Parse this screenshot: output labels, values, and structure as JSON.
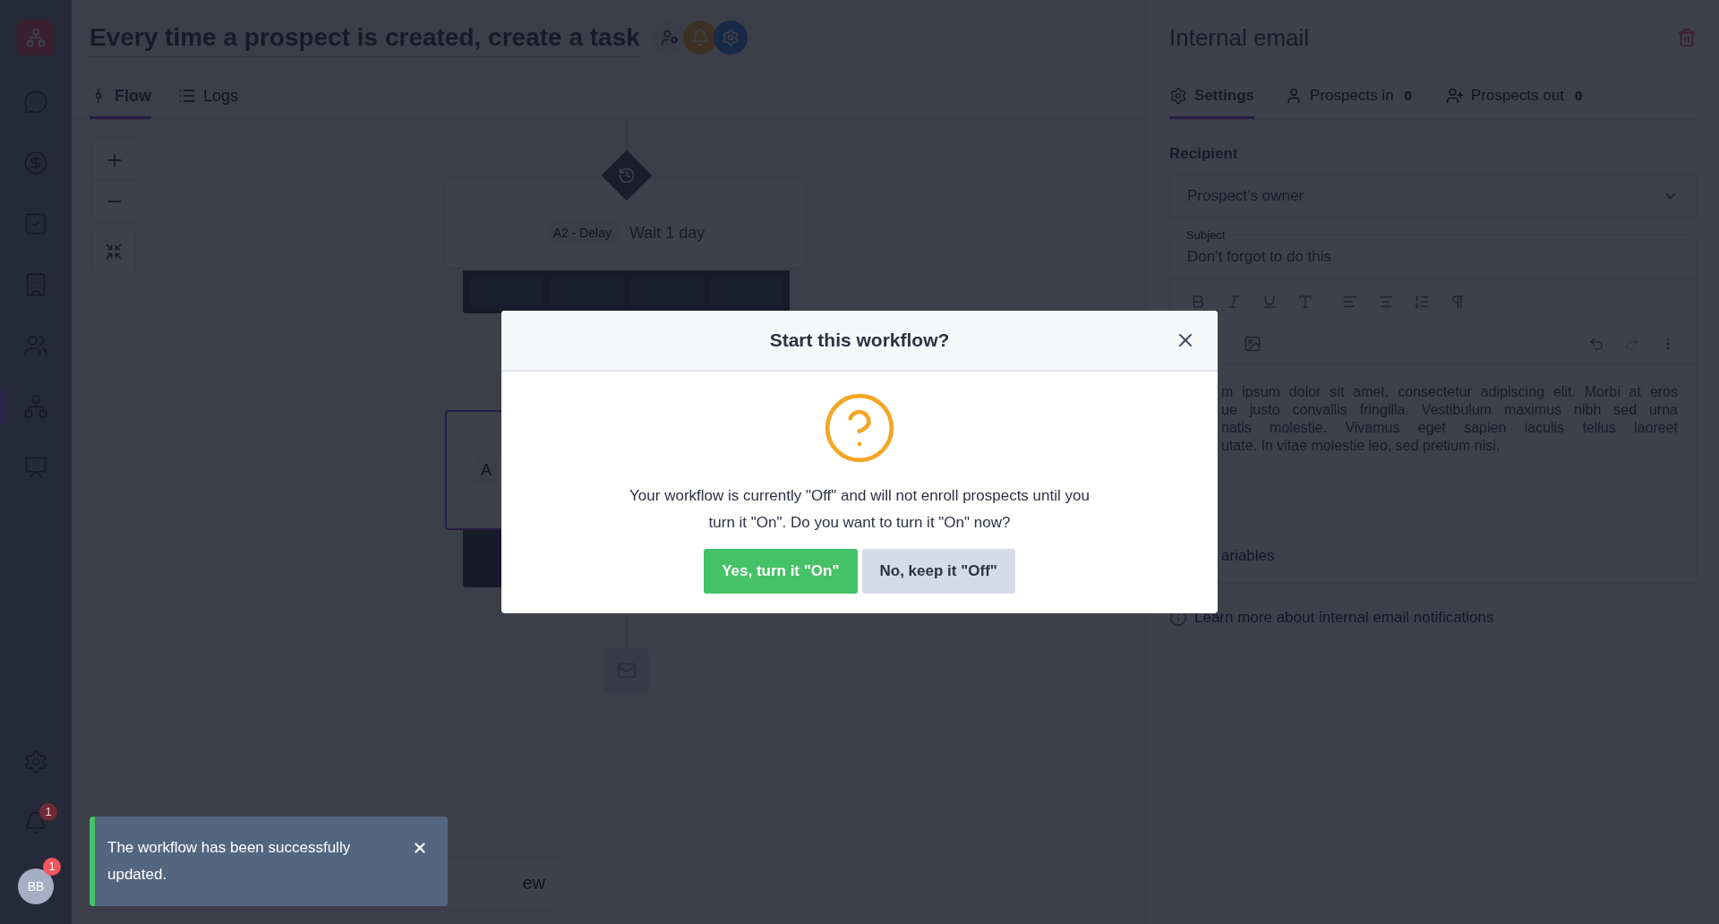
{
  "sidebar": {
    "items": [
      {
        "kind": "chat",
        "selected": false
      },
      {
        "kind": "dollar",
        "selected": false
      },
      {
        "kind": "tasks",
        "selected": false
      },
      {
        "kind": "building",
        "selected": false
      },
      {
        "kind": "people",
        "selected": false
      },
      {
        "kind": "workflow",
        "selected": true
      },
      {
        "kind": "chart",
        "selected": false
      }
    ],
    "notification_badge": "1",
    "avatar": {
      "initials": "BB",
      "badge": "1"
    }
  },
  "workflow": {
    "title": "Every time a prospect is created, create a task",
    "tabs": [
      {
        "label": "Flow",
        "selected": true
      },
      {
        "label": "Logs",
        "selected": false
      }
    ]
  },
  "canvas": {
    "nodes": [
      {
        "tag": "A2 - Delay",
        "label": "Wait 1 day"
      },
      {
        "tag": "A"
      }
    ],
    "bottom_button": "ew"
  },
  "panel": {
    "title": "Internal email",
    "tabs": [
      {
        "label": "Settings",
        "selected": true
      },
      {
        "label": "Prospects in",
        "count": "0",
        "selected": false
      },
      {
        "label": "Prospects out",
        "count": "0",
        "selected": false
      }
    ],
    "recipient_label": "Recipient",
    "recipient_value": "Prospect’s owner",
    "subject_label": "Subject",
    "subject_value": "Don't forgot to do this",
    "body_lines": [
      "m ipsum dolor sit amet, consectetur adipiscing elit. Morbi at eros",
      "ue justo convallis fringilla. Vestibulum maximus nibh sed urna",
      "natis molestie. Vivamus eget sapien iaculis tellus laoreet",
      "utate. In vitae molestie leo, sed pretium nisi."
    ],
    "variables_link": "ariables",
    "learn_more": "Learn more about internal email notifications"
  },
  "dialog": {
    "title": "Start this workflow?",
    "message": "Your workflow is currently \"Off\" and will not enroll prospects until you turn it \"On\". Do you want to turn it \"On\" now?",
    "buttons": [
      {
        "label": "Yes, turn it \"On\"",
        "kind": "primary"
      },
      {
        "label": "No, keep it \"Off\"",
        "kind": "secondary"
      }
    ]
  },
  "toast": {
    "message": "The workflow has been successfully updated."
  }
}
